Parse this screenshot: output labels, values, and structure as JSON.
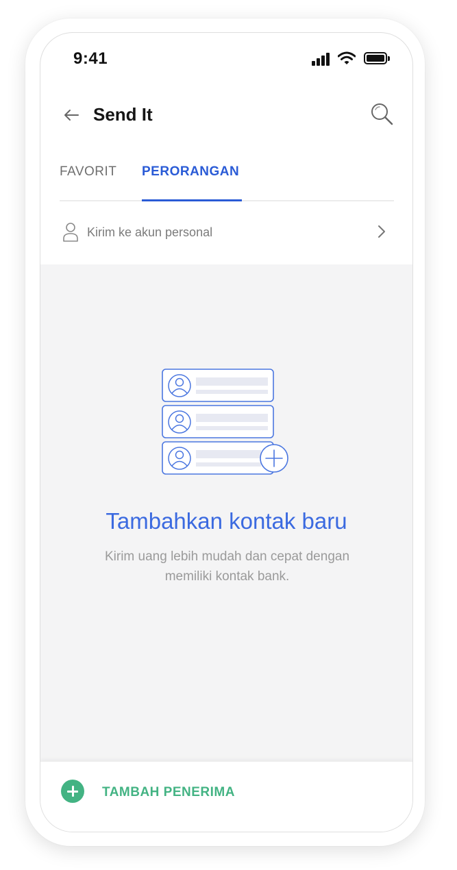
{
  "status_bar": {
    "time": "9:41"
  },
  "header": {
    "title": "Send It",
    "back_icon": "arrow-left-icon",
    "search_icon": "search-icon"
  },
  "tabs": [
    {
      "label": "FAVORIT",
      "active": false
    },
    {
      "label": "PERORANGAN",
      "active": true
    }
  ],
  "personal_row": {
    "label": "Kirim ke akun personal",
    "icon": "person-icon",
    "chevron": "chevron-right-icon"
  },
  "empty_state": {
    "title": "Tambahkan kontak baru",
    "description": "Kirim uang lebih mudah dan cepat dengan memiliki kontak bank.",
    "illustration": "contact-list-illustration"
  },
  "bottom_bar": {
    "add_label": "TAMBAH PENERIMA",
    "icon": "plus-circle-icon"
  },
  "colors": {
    "accent_blue": "#2a5bd6",
    "accent_green": "#43b383",
    "empty_bg": "#f4f4f5"
  }
}
